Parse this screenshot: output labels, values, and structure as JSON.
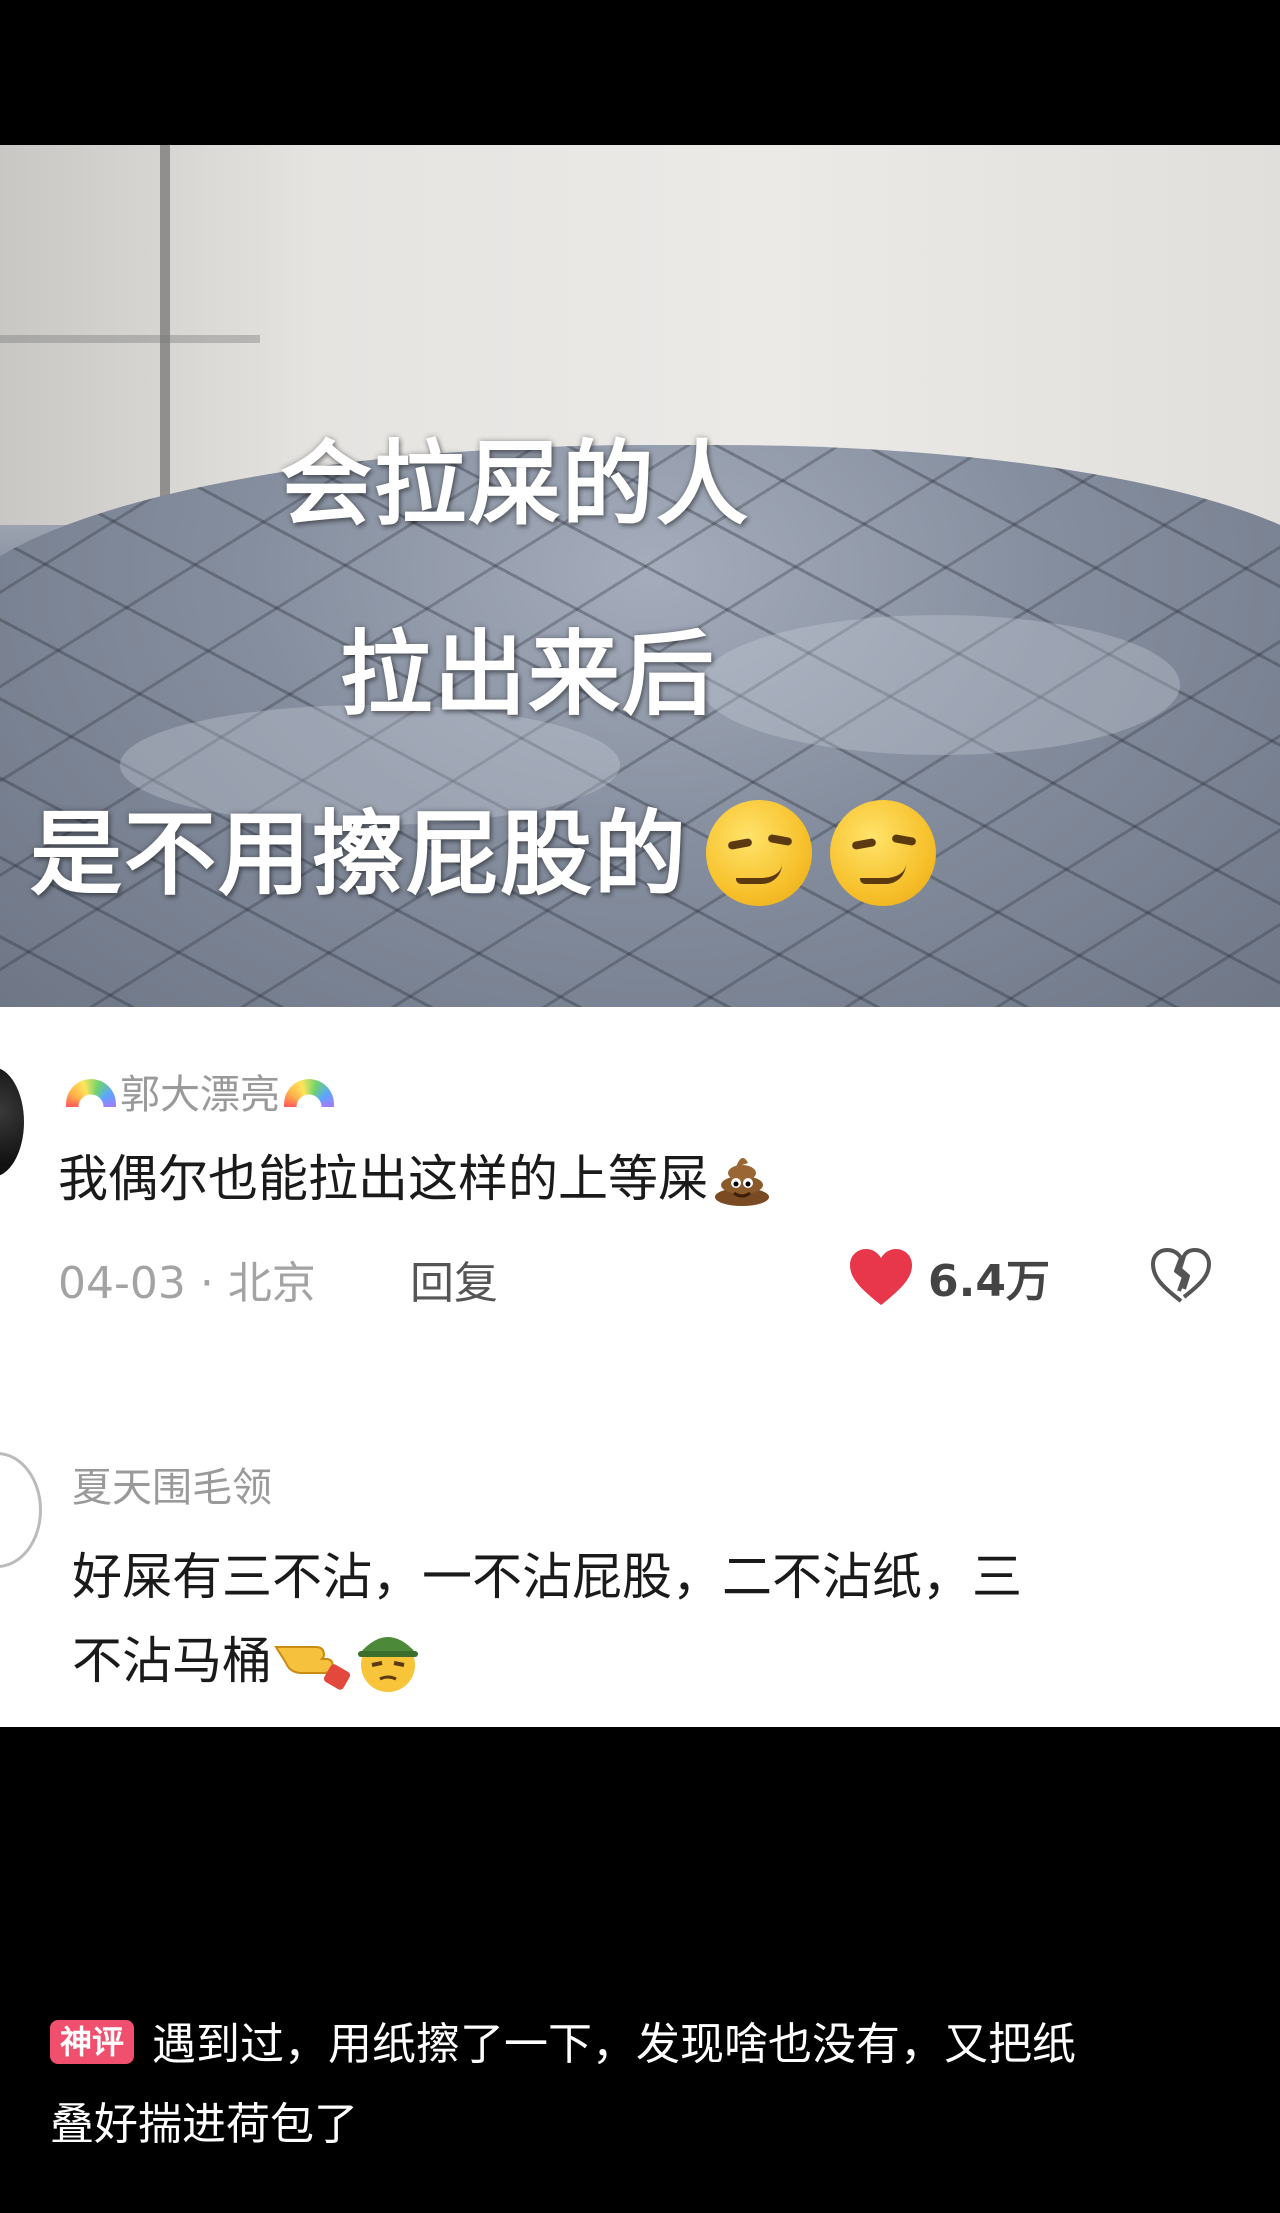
{
  "video": {
    "overlay_lines": [
      "会拉屎的人",
      "拉出来后",
      "是不用擦屁股的"
    ],
    "overlay_emoji": "woozy-face-icon"
  },
  "comments": [
    {
      "username": "郭大漂亮",
      "username_decor": "rainbow-icon",
      "text": "我偶尔也能拉出这样的上等屎",
      "text_emoji": "poop-icon",
      "date_location": "04-03 · 北京",
      "reply_label": "回复",
      "like_count": "6.4万"
    },
    {
      "username": "夏天围毛领",
      "text_line1": "好屎有三不沾，一不沾屁股，二不沾纸，三",
      "text_line2": "不沾马桶"
    }
  ],
  "caption": {
    "tag": "神评",
    "text_line1": "遇到过，用纸擦了一下，发现啥也没有，又把纸",
    "text_line2": "叠好揣进荷包了"
  },
  "colors": {
    "background": "#000000",
    "like_heart": "#e8364a",
    "tag_bg": "#f0506e"
  }
}
